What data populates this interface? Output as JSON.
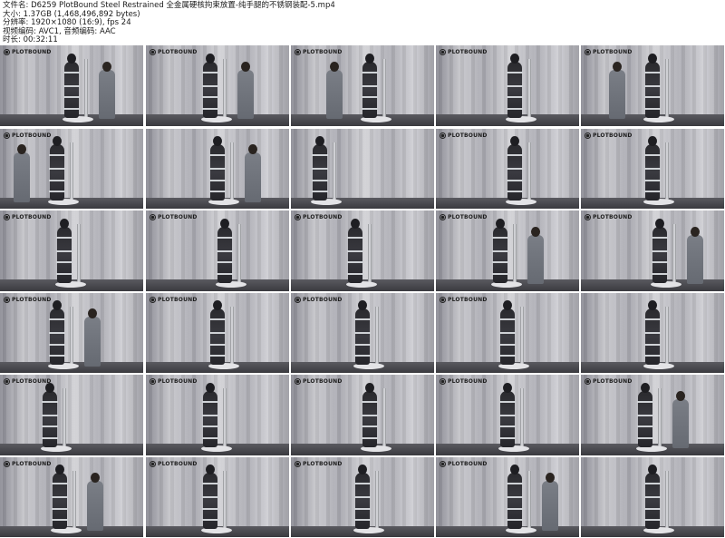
{
  "meta": {
    "filename": "文件名: D6259 PlotBound Steel Restrained 全金属硬核拘束放置-纯手腿的不锈钢装配-5.mp4",
    "size": "大小: 1.37GB (1,468,496,892 bytes)",
    "resolution": "分辨率: 1920×1080 (16:9), fps 24",
    "codec": "视频编码: AVC1, 音频编码: AAC",
    "duration": "时长: 00:32:11"
  },
  "logo_text": "PLOTBOUND",
  "logo_icon": "circle-logo-icon",
  "thumbs": [
    {
      "logo": true
    },
    {
      "logo": true
    },
    {
      "logo": true
    },
    {
      "logo": true
    },
    {
      "logo": true
    },
    {
      "logo": true
    },
    {
      "logo": false
    },
    {
      "logo": false
    },
    {
      "logo": true
    },
    {
      "logo": true
    },
    {
      "logo": true
    },
    {
      "logo": true
    },
    {
      "logo": true
    },
    {
      "logo": true
    },
    {
      "logo": true
    },
    {
      "logo": true
    },
    {
      "logo": true
    },
    {
      "logo": true
    },
    {
      "logo": true
    },
    {
      "logo": false
    },
    {
      "logo": true
    },
    {
      "logo": true
    },
    {
      "logo": true
    },
    {
      "logo": true
    },
    {
      "logo": true
    },
    {
      "logo": true
    },
    {
      "logo": true
    },
    {
      "logo": true
    },
    {
      "logo": true
    },
    {
      "logo": false
    }
  ]
}
